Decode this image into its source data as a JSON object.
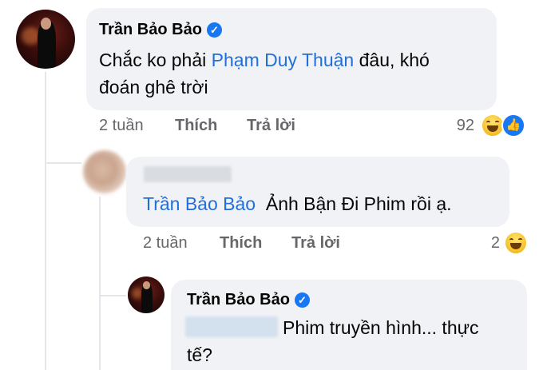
{
  "comments": [
    {
      "author": "Trần Bảo Bảo",
      "verified": true,
      "text_prefix": "Chắc ko phải ",
      "mention": "Phạm Duy Thuận",
      "text_line1_suffix": " đâu, khó",
      "text_line2": "đoán ghê trời",
      "time": "2 tuần",
      "like_label": "Thích",
      "reply_label": "Trả lời",
      "reaction_count": "92",
      "reactions": [
        "haha-emoji-icon",
        "like-reaction-icon"
      ]
    },
    {
      "author": "",
      "author_hidden": true,
      "mention": "Trần Bảo Bảo",
      "text": "Ảnh Bận Đi Phim rồi ạ.",
      "time": "2 tuần",
      "like_label": "Thích",
      "reply_label": "Trả lời",
      "reaction_count": "2",
      "reactions": [
        "haha-emoji-icon"
      ]
    },
    {
      "author": "Trần Bảo Bảo",
      "verified": true,
      "mention_hidden": true,
      "text_line1": "Phim truyền hình... thực",
      "text_line2": "tế?"
    }
  ],
  "colors": {
    "bubble": "#f0f2f5",
    "mention": "#216fdb",
    "meta": "#65676b",
    "verified": "#1877f2"
  }
}
